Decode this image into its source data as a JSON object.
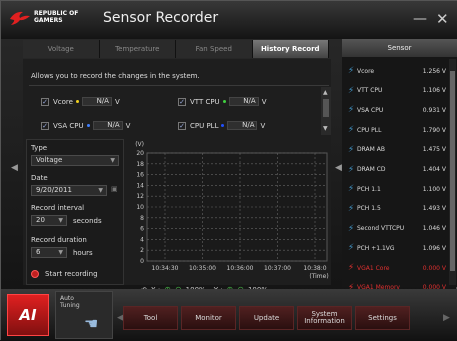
{
  "window": {
    "brand_line1": "REPUBLIC OF",
    "brand_line2": "GAMERS",
    "title": "Sensor Recorder",
    "minimize": "—",
    "close": "✕"
  },
  "tabs": [
    {
      "label": "Voltage",
      "active": false
    },
    {
      "label": "Temperature",
      "active": false
    },
    {
      "label": "Fan Speed",
      "active": false
    },
    {
      "label": "History Record",
      "active": true
    }
  ],
  "main": {
    "description": "Allows you to record the changes in the system.",
    "selected_items": [
      {
        "name": "Vcore",
        "value": "N/A",
        "unit": "V",
        "color": "#f0d020"
      },
      {
        "name": "VTT CPU",
        "value": "N/A",
        "unit": "V",
        "color": "#40d040"
      },
      {
        "name": "VSA CPU",
        "value": "N/A",
        "unit": "V",
        "color": "#4080ff"
      },
      {
        "name": "CPU PLL",
        "value": "N/A",
        "unit": "V",
        "color": "#2050ff"
      }
    ]
  },
  "controls": {
    "type_label": "Type",
    "type_value": "Voltage",
    "date_label": "Date",
    "date_value": "9/20/2011",
    "interval_label": "Record interval",
    "interval_value": "20",
    "interval_unit": "seconds",
    "duration_label": "Record duration",
    "duration_value": "6",
    "duration_unit": "hours",
    "start_label": "Start recording"
  },
  "zoom": {
    "x_label": "X :",
    "x_value": "100%",
    "y_label": "Y :",
    "y_value": "100%"
  },
  "chart_data": {
    "type": "line",
    "ylabel": "(V)",
    "xlabel": "(Time)",
    "ylim": [
      0,
      20
    ],
    "y_ticks": [
      "20",
      "18",
      "16",
      "14",
      "12",
      "10",
      "8",
      "6",
      "4",
      "2",
      "0"
    ],
    "x_ticks": [
      "10:34:30",
      "10:35:00",
      "10:36:00",
      "10:37:00",
      "10:38:0"
    ],
    "series": [],
    "grid": true
  },
  "sensor": {
    "header": "Sensor",
    "items": [
      {
        "name": "Vcore",
        "value": "1.256 V",
        "alert": false
      },
      {
        "name": "VTT CPU",
        "value": "1.106 V",
        "alert": false
      },
      {
        "name": "VSA CPU",
        "value": "0.931 V",
        "alert": false
      },
      {
        "name": "CPU PLL",
        "value": "1.790 V",
        "alert": false
      },
      {
        "name": "DRAM AB",
        "value": "1.475 V",
        "alert": false
      },
      {
        "name": "DRAM CD",
        "value": "1.404 V",
        "alert": false
      },
      {
        "name": "PCH 1.1",
        "value": "1.100 V",
        "alert": false
      },
      {
        "name": "PCH 1.5",
        "value": "1.493 V",
        "alert": false
      },
      {
        "name": "Second VTTCPU",
        "value": "1.046 V",
        "alert": false
      },
      {
        "name": "PCH +1.1VG",
        "value": "1.096 V",
        "alert": false
      },
      {
        "name": "VGA1 Core",
        "value": "0.000 V",
        "alert": true
      },
      {
        "name": "VGA1 Memory",
        "value": "0.000 V",
        "alert": true
      }
    ]
  },
  "dock": {
    "logo": "AI",
    "autotune_line1": "Auto",
    "autotune_line2": "Tuning",
    "buttons": [
      "Tool",
      "Monitor",
      "Update",
      "System Information",
      "Settings"
    ]
  },
  "colors": {
    "accent": "#c02020",
    "sensor_icon": "#4499cc",
    "alert": "#e03030"
  }
}
